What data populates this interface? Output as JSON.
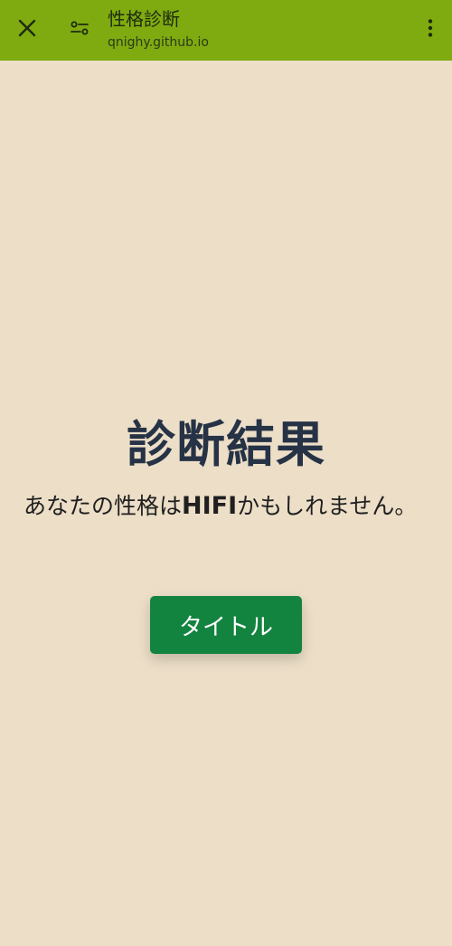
{
  "browser": {
    "title": "性格診断",
    "url": "qnighy.github.io",
    "icons": {
      "close": "close-icon",
      "settings": "tune-icon",
      "menu": "more-vert-icon"
    },
    "bar_color": "#7fab10"
  },
  "main": {
    "heading": "診断結果",
    "result_prefix": "あなたの性格は",
    "result_type": "HIFI",
    "result_suffix": "かもしれません。",
    "button_label": "タイトル",
    "background_color": "#ecdec7",
    "button_color": "#13843f"
  }
}
